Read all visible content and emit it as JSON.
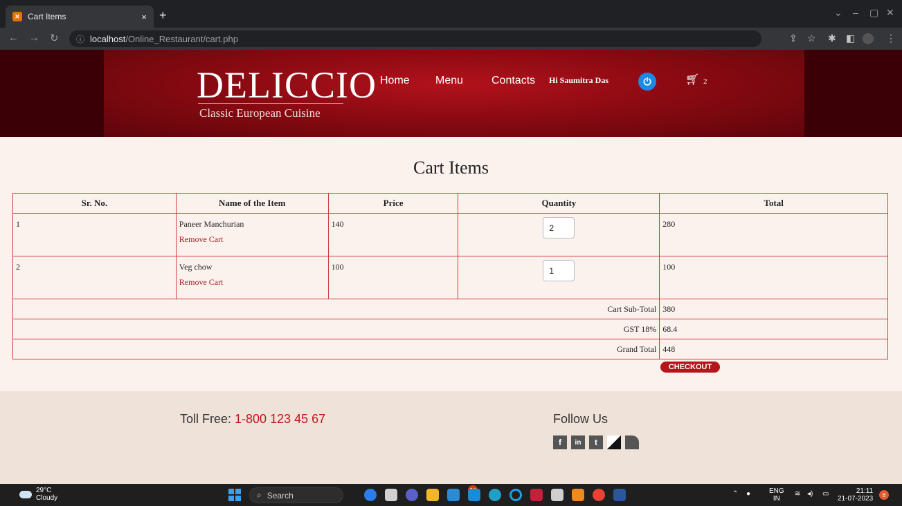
{
  "browser": {
    "tab_title": "Cart Items",
    "tab_close": "×",
    "new_tab": "+",
    "url_host": "localhost",
    "url_path": "/Online_Restaurant/cart.php"
  },
  "header": {
    "logo": "DELICCIO",
    "tagline": "Classic European Cuisine",
    "nav": [
      "Home",
      "Menu",
      "Contacts"
    ],
    "greeting": "Hi Saumitra Das",
    "cart_count": "2"
  },
  "cart": {
    "title": "Cart Items",
    "columns": [
      "Sr. No.",
      "Name of the Item",
      "Price",
      "Quantity",
      "Total"
    ],
    "items": [
      {
        "sr": "1",
        "name": "Paneer Manchurian",
        "remove": "Remove Cart",
        "price": "140",
        "qty": "2",
        "total": "280"
      },
      {
        "sr": "2",
        "name": "Veg chow",
        "remove": "Remove Cart",
        "price": "100",
        "qty": "1",
        "total": "100"
      }
    ],
    "subtotal_label": "Cart Sub-Total",
    "subtotal": "380",
    "gst_label": "GST 18%",
    "gst": "68.4",
    "grand_label": "Grand Total",
    "grand": "448",
    "checkout": "CHECKOUT"
  },
  "footer": {
    "toll_label": "Toll Free: ",
    "toll_number": "1-800 123 45 67",
    "follow": "Follow Us",
    "social": [
      "f",
      "in",
      "t",
      "",
      ""
    ]
  },
  "taskbar": {
    "temp": "29°C",
    "weather": "Cloudy",
    "search": "Search",
    "badge": "24",
    "lang1": "ENG",
    "lang2": "IN",
    "time": "21:11",
    "date": "21-07-2023",
    "notif": "6"
  },
  "colors": {
    "accent": "#b5141b",
    "header_bg": "#8c0a12",
    "page_bg": "#fbf2ee",
    "border": "#d23a3a"
  }
}
